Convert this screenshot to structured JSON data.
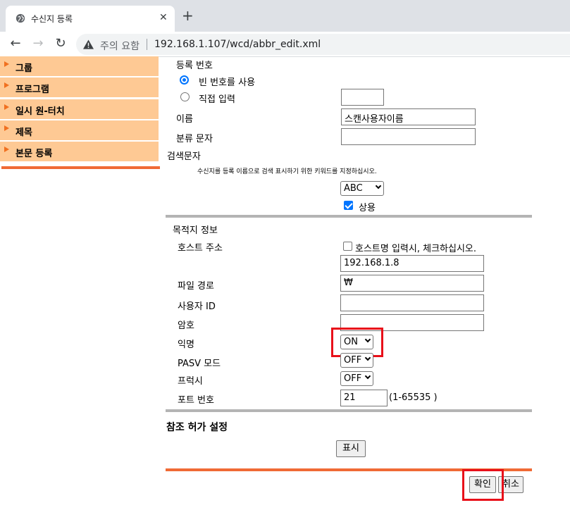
{
  "browser": {
    "tab_title": "수신지 등록",
    "tab_close": "✕",
    "new_tab": "+",
    "security_warning": "주의 요함",
    "url": "192.168.1.107/wcd/abbr_edit.xml",
    "back": "←",
    "forward": "→",
    "reload": "↻"
  },
  "sidebar": {
    "items": [
      {
        "label": "그룹"
      },
      {
        "label": "프로그램"
      },
      {
        "label": "일시 원-터치"
      },
      {
        "label": "제목"
      },
      {
        "label": "본문 등록"
      }
    ],
    "accent_color": "#fec994",
    "bar_color": "#f06a35"
  },
  "form": {
    "reg_number_label": "등록 번호",
    "radio_empty_label": "빈 번호를 사용",
    "radio_direct_label": "직접 입력",
    "direct_value": "",
    "name_label": "이름",
    "name_value": "스캔사용자이름",
    "category_label": "분류 문자",
    "category_value": "",
    "search_label": "검색문자",
    "search_note": "수신지를 등록 이름으로 검색 표시하기 위한 키워드를 지정하십시오.",
    "search_select": "ABC",
    "frequent_label": "상용",
    "destination_title": "목적지 정보",
    "host_label": "호스트 주소",
    "host_check_label": "호스트명 입력시, 체크하십시오.",
    "host_value": "192.168.1.8",
    "path_label": "파일 경로",
    "path_value": "₩",
    "user_label": "사용자 ID",
    "user_value": "",
    "password_label": "암호",
    "password_value": "",
    "anon_label": "익명",
    "anon_value": "ON",
    "pasv_label": "PASV 모드",
    "pasv_value": "OFF",
    "proxy_label": "프럭시",
    "proxy_value": "OFF",
    "port_label": "포트 번호",
    "port_value": "21",
    "port_range": "(1-65535 )",
    "ref_title": "참조 허가 설정",
    "show_button": "표시",
    "ok_button": "확인",
    "cancel_button": "취소"
  },
  "colors": {
    "highlight": "#e8101a",
    "accent": "#0075ff"
  }
}
